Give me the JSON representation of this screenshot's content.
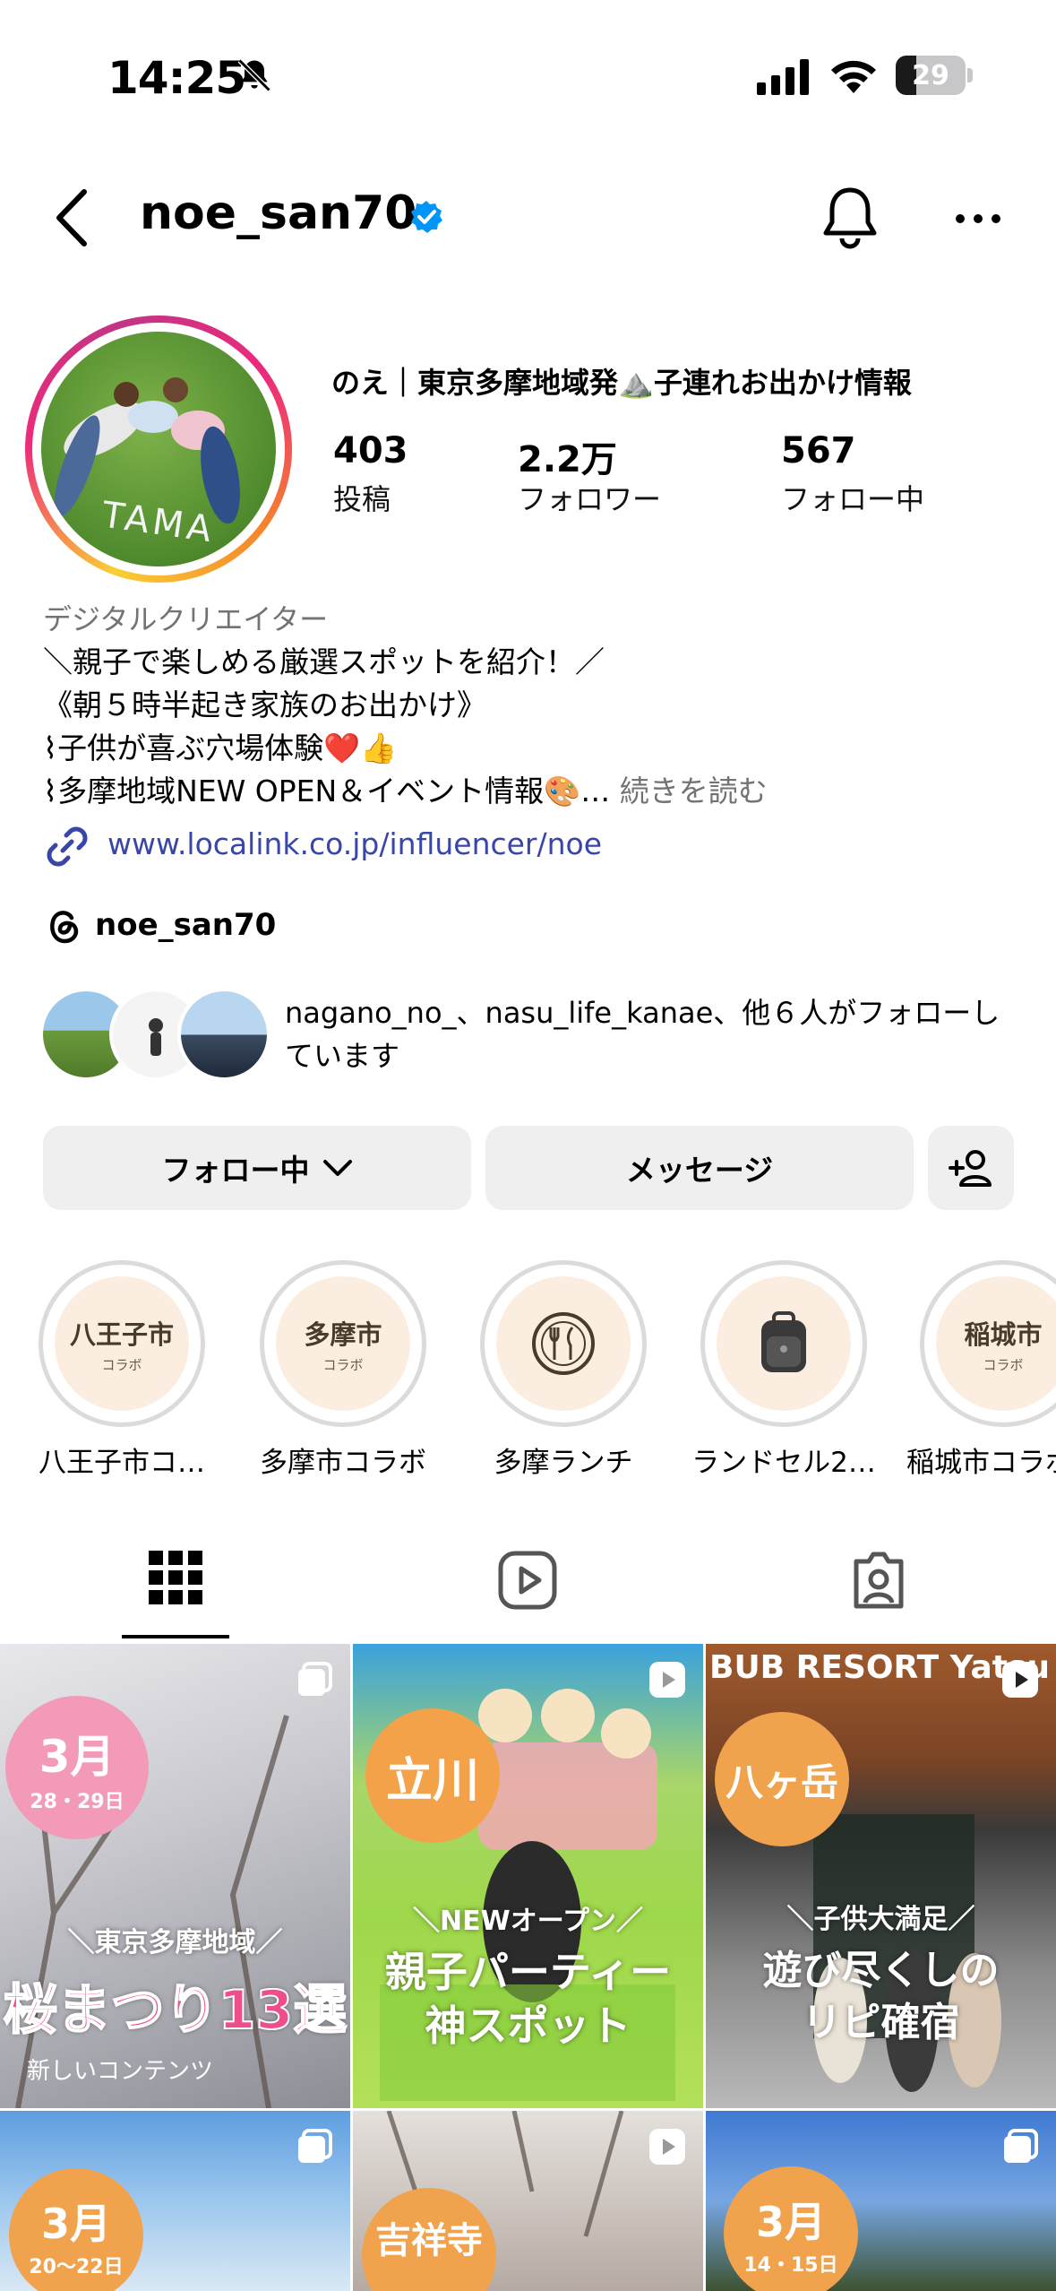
{
  "status_bar": {
    "time": "14:25",
    "battery": "29",
    "battery_level_percent": 29
  },
  "header": {
    "username": "noe_san70"
  },
  "profile": {
    "avatar_text": "TAMA",
    "full_name": "のえ｜東京多摩地域発⛰️子連れお出かけ情報",
    "stats": [
      {
        "value": "403",
        "label": "投稿"
      },
      {
        "value": "2.2万",
        "label": "フォロワー"
      },
      {
        "value": "567",
        "label": "フォロー中"
      }
    ],
    "category": "デジタルクリエイター",
    "bio": [
      "＼親子で楽しめる厳選スポットを紹介！／",
      "《朝５時半起き家族のお出かけ》",
      "⌇子供が喜ぶ穴場体験❤️👍",
      "⌇多摩地域NEW OPEN＆イベント情報🎨…"
    ],
    "bio_more": "続きを読む",
    "link": "www.localink.co.jp/influencer/noe",
    "threads": "noe_san70",
    "followed_by": "nagano_no_、nasu_life_kanae、他６人がフォローしています"
  },
  "buttons": {
    "following": "フォロー中",
    "message": "メッセージ"
  },
  "highlights": [
    {
      "title": "八王子市",
      "sub": "コラボ",
      "label": "八王子市コ…"
    },
    {
      "title": "多摩市",
      "sub": "コラボ",
      "label": "多摩市コラボ"
    },
    {
      "title": "",
      "sub": "",
      "label": "多摩ランチ"
    },
    {
      "title": "",
      "sub": "",
      "label": "ランドセル2…"
    },
    {
      "title": "稲城市",
      "sub": "コラボ",
      "label": "稲城市コラボ"
    }
  ],
  "posts": [
    {
      "badge": "3月",
      "sub": "28・29日",
      "line1": "＼東京多摩地域／",
      "line2": "桜まつり13選",
      "footer": "新しいコンテンツ"
    },
    {
      "badge": "立川",
      "sub": "",
      "line1": "＼NEWオープン／",
      "line2": "親子パーティー",
      "line3": "神スポット"
    },
    {
      "badge": "八ヶ岳",
      "sub": "",
      "top": "BUB RESORT Yatsu",
      "line1": "＼子供大満足／",
      "line2": "遊び尽くしの",
      "line3": "リピ確宿"
    },
    {
      "badge": "3月",
      "sub": "20〜22日"
    },
    {
      "badge": "吉祥寺",
      "sub": ""
    },
    {
      "badge": "3月",
      "sub": "14・15日"
    }
  ],
  "colors": {
    "link": "#3845a9",
    "verified": "#0095f6",
    "button_bg": "#efefef",
    "secondary_text": "#737373"
  }
}
